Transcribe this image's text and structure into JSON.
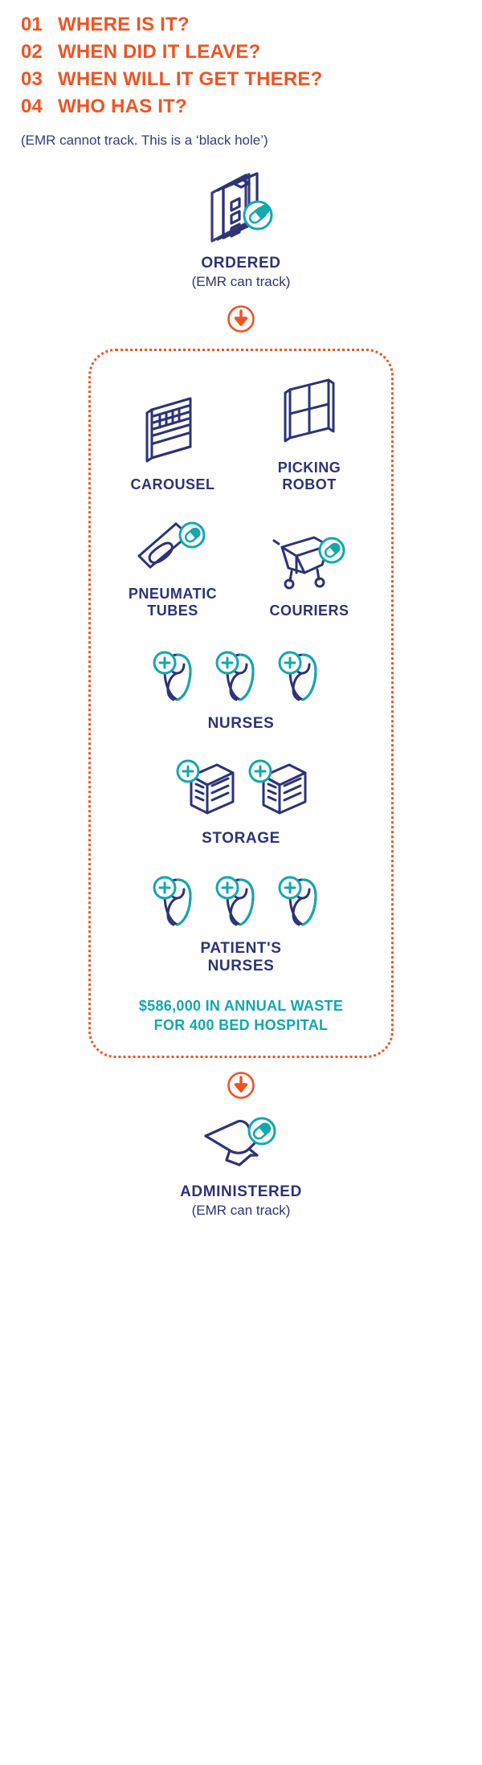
{
  "questions": [
    {
      "num": "01",
      "text": "WHERE IS IT?"
    },
    {
      "num": "02",
      "text": "WHEN DID IT LEAVE?"
    },
    {
      "num": "03",
      "text": "WHEN WILL IT GET THERE?"
    },
    {
      "num": "04",
      "text": "WHO HAS IT?"
    }
  ],
  "emr_note": "(EMR cannot track. This is a ‘black hole’)",
  "ordered": {
    "title": "ORDERED",
    "subtitle": "(EMR can track)",
    "icon": "clipboard-pill-icon"
  },
  "arrow_top": {
    "icon": "down-arrow-circle-icon"
  },
  "arrow_bottom": {
    "icon": "down-arrow-circle-icon"
  },
  "blackhole": {
    "row1": [
      {
        "label": "CAROUSEL",
        "icon": "carousel-icon"
      },
      {
        "label": "PICKING\nROBOT",
        "label_line1": "PICKING",
        "label_line2": "ROBOT",
        "icon": "picking-robot-icon"
      }
    ],
    "row2": [
      {
        "label_line1": "PNEUMATIC",
        "label_line2": "TUBES",
        "icon": "pneumatic-tube-icon"
      },
      {
        "label_line1": "COURIERS",
        "label_line2": "",
        "icon": "courier-cart-icon"
      }
    ],
    "nurses": {
      "label": "NURSES",
      "count": 3,
      "icon": "nurse-icon"
    },
    "storage": {
      "label": "STORAGE",
      "count": 2,
      "icon": "storage-cabinet-icon"
    },
    "patients_nurses": {
      "label_line1": "PATIENT'S",
      "label_line2": "NURSES",
      "count": 3,
      "icon": "nurse-icon"
    },
    "waste_line1": "$586,000 IN ANNUAL WASTE",
    "waste_line2": "FOR 400 BED HOSPITAL"
  },
  "administered": {
    "title": "ADMINISTERED",
    "subtitle": "(EMR can track)",
    "icon": "hand-pill-icon"
  },
  "colors": {
    "orange": "#ef5423",
    "navy": "#2e3277",
    "teal": "#11a8ae",
    "background": "#ffffff"
  }
}
